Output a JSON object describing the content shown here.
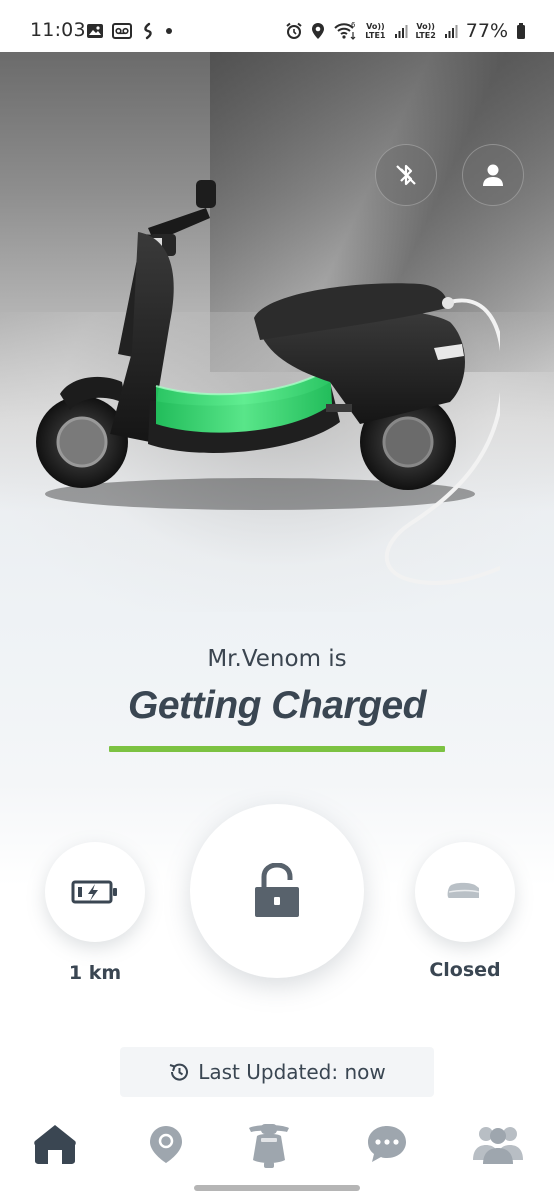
{
  "status_bar": {
    "time": "11:03",
    "net1_top": "Vo))",
    "net1_bottom": "LTE1",
    "net2_top": "Vo))",
    "net2_bottom": "LTE2",
    "battery_percent": "77%",
    "icons": [
      "gallery-icon",
      "voicemail-icon",
      "fan-icon",
      "dot-icon",
      "alarm-icon",
      "location-icon",
      "wifi-6-icon",
      "signal-icon",
      "battery-icon"
    ]
  },
  "hero": {
    "vehicle_image": "scooter-charging-illustration",
    "charge_glow_color": "#3ee07a",
    "buttons": [
      "bluetooth-off-icon",
      "profile-icon"
    ]
  },
  "title": {
    "owner_line": "Mr.Venom is",
    "status": "Getting Charged",
    "accent_color": "#7cc242"
  },
  "controls": {
    "range_value": "1 km",
    "lock_state_icon": "unlocked-padlock-icon",
    "seat_status": "Closed"
  },
  "footer": {
    "last_updated": "Last Updated: now"
  },
  "bottom_nav": {
    "items": [
      "home",
      "location",
      "vehicle",
      "chat",
      "community"
    ],
    "active": "home"
  }
}
